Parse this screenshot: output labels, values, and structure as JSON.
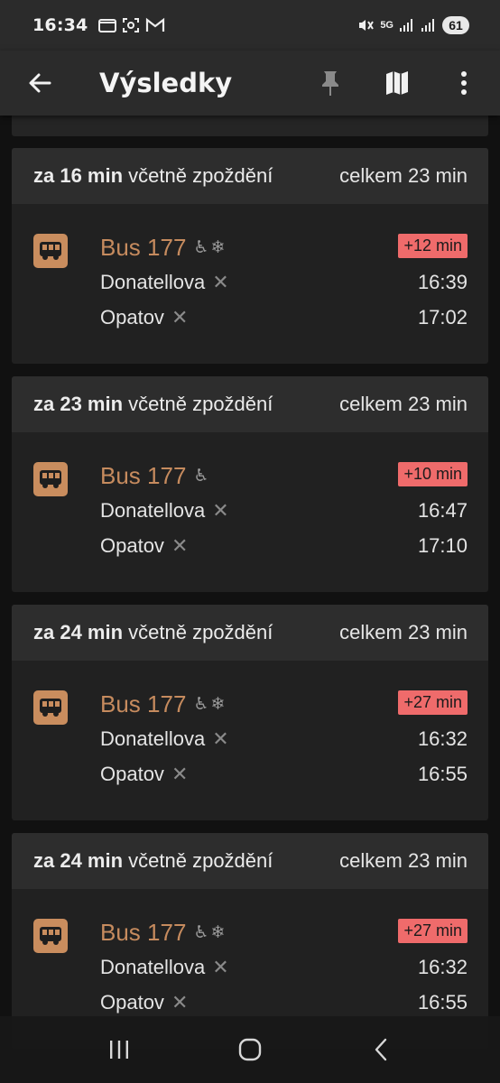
{
  "status_bar": {
    "time": "16:34",
    "network": "5G",
    "battery": "61",
    "left_icons": [
      "folder-icon",
      "screenshot-icon",
      "gmail-icon"
    ],
    "right_icons": [
      "mute-icon",
      "signal-icon",
      "signal-icon"
    ]
  },
  "app_bar": {
    "title": "Výsledky",
    "back_icon": "arrow-left-icon",
    "actions": [
      "pin-icon",
      "map-icon",
      "more-vert-icon"
    ]
  },
  "results": [
    {
      "wait_strong": "za 16 min",
      "wait_rest": " včetně zpoždění",
      "total": "celkem 23 min",
      "line": "Bus 177",
      "accessibility": [
        "♿",
        "❄"
      ],
      "delay": "+12 min",
      "from": "Donatellova",
      "to": "Opatov",
      "departure": "16:39",
      "arrival": "17:02"
    },
    {
      "wait_strong": "za 23 min",
      "wait_rest": " včetně zpoždění",
      "total": "celkem 23 min",
      "line": "Bus 177",
      "accessibility": [
        "♿"
      ],
      "delay": "+10 min",
      "from": "Donatellova",
      "to": "Opatov",
      "departure": "16:47",
      "arrival": "17:10"
    },
    {
      "wait_strong": "za 24 min",
      "wait_rest": " včetně zpoždění",
      "total": "celkem 23 min",
      "line": "Bus 177",
      "accessibility": [
        "♿",
        "❄"
      ],
      "delay": "+27 min",
      "from": "Donatellova",
      "to": "Opatov",
      "departure": "16:32",
      "arrival": "16:55"
    },
    {
      "wait_strong": "za 24 min",
      "wait_rest": " včetně zpoždění",
      "total": "celkem 23 min",
      "line": "Bus 177",
      "accessibility": [
        "♿",
        "❄"
      ],
      "delay": "+27 min",
      "from": "Donatellova",
      "to": "Opatov",
      "departure": "16:32",
      "arrival": "16:55"
    }
  ],
  "nav_bar": [
    "recents-icon",
    "home-icon",
    "back-icon"
  ],
  "colors": {
    "accent": "#c68b5e",
    "delay_bg": "#ef6b6b",
    "card_bg": "#212121",
    "card_header_bg": "#2d2d2d"
  }
}
